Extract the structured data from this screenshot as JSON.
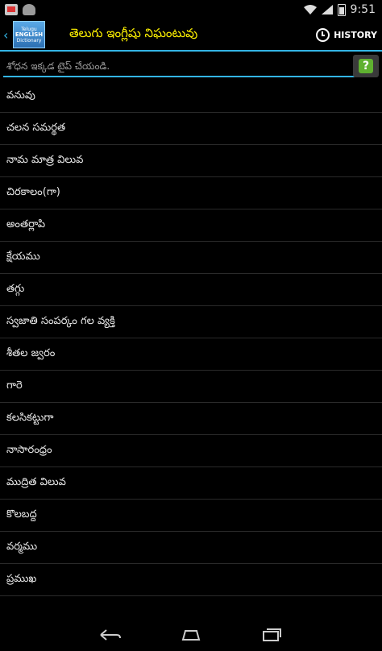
{
  "status_bar": {
    "time": "9:51",
    "icons": [
      "notification-app-icon",
      "notification-cat-icon",
      "wifi-icon",
      "signal-icon",
      "battery-icon"
    ]
  },
  "action_bar": {
    "logo_text": [
      "Telugu",
      "ENGLISH",
      "Dictionary"
    ],
    "title": "తెలుగు ఇంగ్లీషు నిఘంటువు",
    "history_label": "HISTORY"
  },
  "search": {
    "placeholder": "శోధన ఇక్కడ టైప్ చేయండి.",
    "help_label": "?"
  },
  "words": [
    "వనువు",
    "చలన సమర్థత",
    "నామ మాత్ర విలువ",
    "చిరకాలం(గా)",
    "అంతర్లాపి",
    "క్షేయము",
    "తగ్గు",
    "స్వజాతి సంపర్కం గల వ్యక్తి",
    "శీతల జ్వరం",
    "గారె",
    "కలసికట్టుగా",
    "నాసారంధ్రం",
    "ముద్రిత విలువ",
    "కొలబద్ద",
    "వర్మము",
    "ప్రముఖ"
  ],
  "colors": {
    "accent": "#33b5e5",
    "title": "#fff200",
    "help": "#5fb130"
  }
}
